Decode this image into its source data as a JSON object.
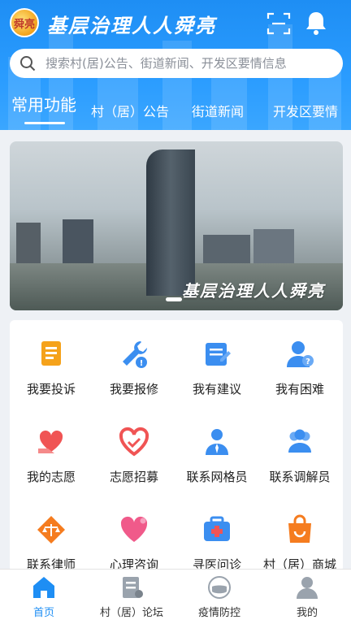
{
  "header": {
    "app_title": "基层治理人人舜亮",
    "logo_text": "舜亮",
    "scan_icon": "scan-icon",
    "bell_icon": "bell-icon"
  },
  "search": {
    "placeholder": "搜索村(居)公告、街道新闻、开发区要情信息",
    "value": ""
  },
  "tabs": [
    {
      "label": "常用功能",
      "active": true
    },
    {
      "label": "村（居）公告",
      "active": false
    },
    {
      "label": "街道新闻",
      "active": false
    },
    {
      "label": "开发区要情",
      "active": false
    }
  ],
  "banner": {
    "caption": "基层治理人人舜亮"
  },
  "functions": [
    {
      "label": "我要投诉",
      "icon": "complaint-icon"
    },
    {
      "label": "我要报修",
      "icon": "repair-icon"
    },
    {
      "label": "我有建议",
      "icon": "suggestion-icon"
    },
    {
      "label": "我有困难",
      "icon": "help-icon"
    },
    {
      "label": "我的志愿",
      "icon": "volunteer-icon"
    },
    {
      "label": "志愿招募",
      "icon": "recruit-icon"
    },
    {
      "label": "联系网格员",
      "icon": "grid-worker-icon"
    },
    {
      "label": "联系调解员",
      "icon": "mediator-icon"
    },
    {
      "label": "联系律师",
      "icon": "lawyer-icon"
    },
    {
      "label": "心理咨询",
      "icon": "psychology-icon"
    },
    {
      "label": "寻医问诊",
      "icon": "medical-icon"
    },
    {
      "label": "村（居）商城",
      "icon": "shop-icon"
    }
  ],
  "bottom_nav": [
    {
      "label": "首页",
      "icon": "home-icon",
      "active": true
    },
    {
      "label": "村（居）论坛",
      "icon": "forum-icon",
      "active": false
    },
    {
      "label": "疫情防控",
      "icon": "mask-icon",
      "active": false
    },
    {
      "label": "我的",
      "icon": "user-icon",
      "active": false
    }
  ],
  "colors": {
    "brand_blue": "#1e8ef4",
    "icon_orange": "#f5a21b",
    "icon_blue": "#3b8ef0",
    "icon_red": "#f05454"
  }
}
